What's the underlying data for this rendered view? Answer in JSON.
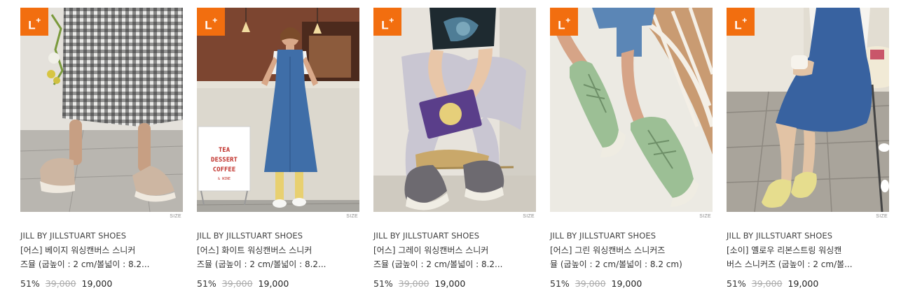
{
  "badge_label": "L",
  "badge_plus": "+",
  "size_label": "SIZE",
  "colors": {
    "badge": "#f26e0f"
  },
  "products": [
    {
      "brand": "JILL BY JILLSTUART SHOES",
      "name_line1": "[어스] 베이지 워싱캔버스 스니커",
      "name_line2": "즈뮬 (굽높이 : 2 cm/볼넓이 : 8.2...",
      "discount": "51%",
      "original_price": "39,000",
      "sale_price": "19,000"
    },
    {
      "brand": "JILL BY JILLSTUART SHOES",
      "name_line1": "[어스] 화이트 워싱캔버스 스니커",
      "name_line2": "즈뮬 (굽높이 : 2 cm/볼넓이 : 8.2...",
      "discount": "51%",
      "original_price": "39,000",
      "sale_price": "19,000",
      "sign_lines": [
        "TEA",
        "DESSERT",
        "COFFEE",
        "& WINE"
      ]
    },
    {
      "brand": "JILL BY JILLSTUART SHOES",
      "name_line1": "[어스] 그레이 워싱캔버스 스니커",
      "name_line2": "즈뮬 (굽높이 : 2 cm/볼넓이 : 8.2...",
      "discount": "51%",
      "original_price": "39,000",
      "sale_price": "19,000"
    },
    {
      "brand": "JILL BY JILLSTUART SHOES",
      "name_line1": "[어스] 그린 워싱캔버스 스니커즈",
      "name_line2": "뮬 (굽높이 : 2 cm/볼넓이 : 8.2 cm)",
      "discount": "51%",
      "original_price": "39,000",
      "sale_price": "19,000"
    },
    {
      "brand": "JILL BY JILLSTUART SHOES",
      "name_line1": "[소이] 옐로우 리본스트링 워싱캔",
      "name_line2": "버스 스니커즈 (굽높이 : 2 cm/볼...",
      "discount": "51%",
      "original_price": "39,000",
      "sale_price": "19,000"
    }
  ]
}
